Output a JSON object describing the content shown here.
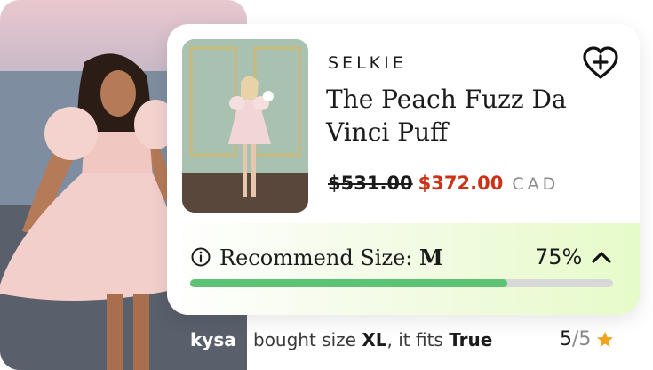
{
  "product": {
    "brand": "SELKIE",
    "title": "The Peach Fuzz Da Vinci Puff",
    "price_original": "$531.00",
    "price_sale": "$372.00",
    "currency": "CAD"
  },
  "recommendation": {
    "label": "Recommend Size:",
    "size": "M",
    "confidence_text": "75%",
    "confidence_fraction": 0.75
  },
  "review": {
    "reviewer": "kysa",
    "bought_prefix": "bought size",
    "bought_size": "XL",
    "fits_prefix": ", it fits",
    "fits_value": "True",
    "score": "5",
    "slash": "/",
    "max": "5"
  },
  "colors": {
    "sale_price": "#cc3316",
    "progress_fill": "#5cc374",
    "progress_track": "#d8d8d8",
    "star": "#f2a31a"
  },
  "icons": {
    "wishlist": "heart-plus-icon",
    "info": "info-icon",
    "collapse": "chevron-up-icon",
    "rating": "star-icon"
  }
}
